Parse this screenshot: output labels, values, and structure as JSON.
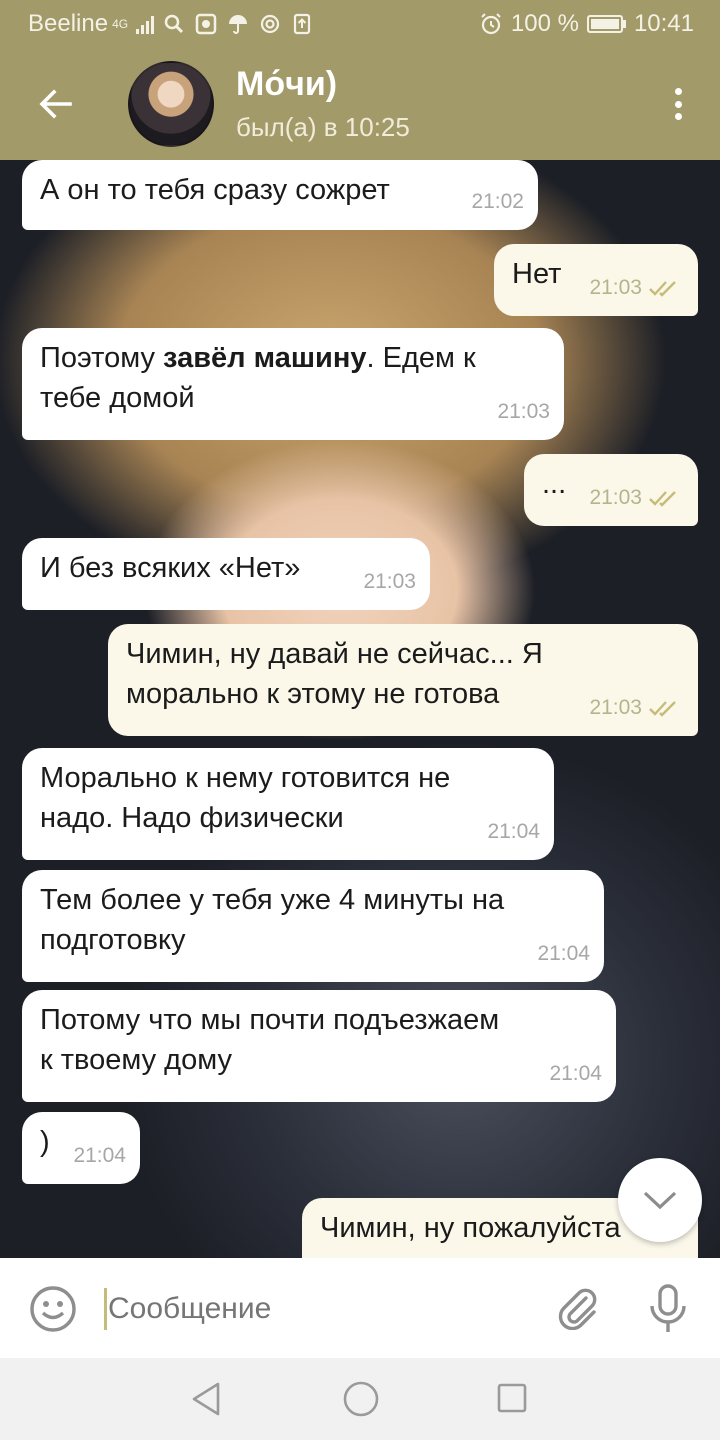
{
  "status_bar": {
    "carrier": "Beeline",
    "network": "4G",
    "battery": "100 %",
    "time": "10:41"
  },
  "header": {
    "title": "Мо́чи)",
    "subtitle": "был(а) в 10:25"
  },
  "messages": [
    {
      "dir": "in",
      "text": "А он то тебя сразу сожрет",
      "time": "21:02"
    },
    {
      "dir": "out",
      "text": "Нет",
      "time": "21:03",
      "read": true
    },
    {
      "dir": "in",
      "text_before": "Поэтому ",
      "text_bold": "завёл машину",
      "text_after": ". Едем к\nтебе домой",
      "time": "21:03"
    },
    {
      "dir": "out",
      "text": "...",
      "time": "21:03",
      "read": true
    },
    {
      "dir": "in",
      "text": "И без всяких «Нет»",
      "time": "21:03"
    },
    {
      "dir": "out",
      "text": "Чимин, ну давай не сейчас... Я\nморально к этому не готова",
      "time": "21:03",
      "read": true
    },
    {
      "dir": "in",
      "text": "Морально к нему готовится не\nнадо. Надо физически",
      "time": "21:04"
    },
    {
      "dir": "in",
      "text": "Тем более у тебя уже 4 минуты на\nподготовку",
      "time": "21:04"
    },
    {
      "dir": "in",
      "text": "Потому что мы почти подъезжаем\nк твоему дому",
      "time": "21:04"
    },
    {
      "dir": "in",
      "text": ")",
      "time": "21:04"
    },
    {
      "dir": "out",
      "text": "Чимин, ну пожалуйста",
      "time": ""
    }
  ],
  "composer": {
    "placeholder": "Сообщение"
  },
  "icons": {
    "back": "arrow-left-icon",
    "menu": "more-vertical-icon",
    "emoji": "smile-icon",
    "attach": "paperclip-icon",
    "mic": "microphone-icon",
    "scroll": "chevron-down-icon"
  },
  "colors": {
    "header": "#a39a69",
    "outgoing_bubble": "#fbf8ea",
    "incoming_bubble": "#ffffff",
    "read_check": "#c7bb7a"
  }
}
